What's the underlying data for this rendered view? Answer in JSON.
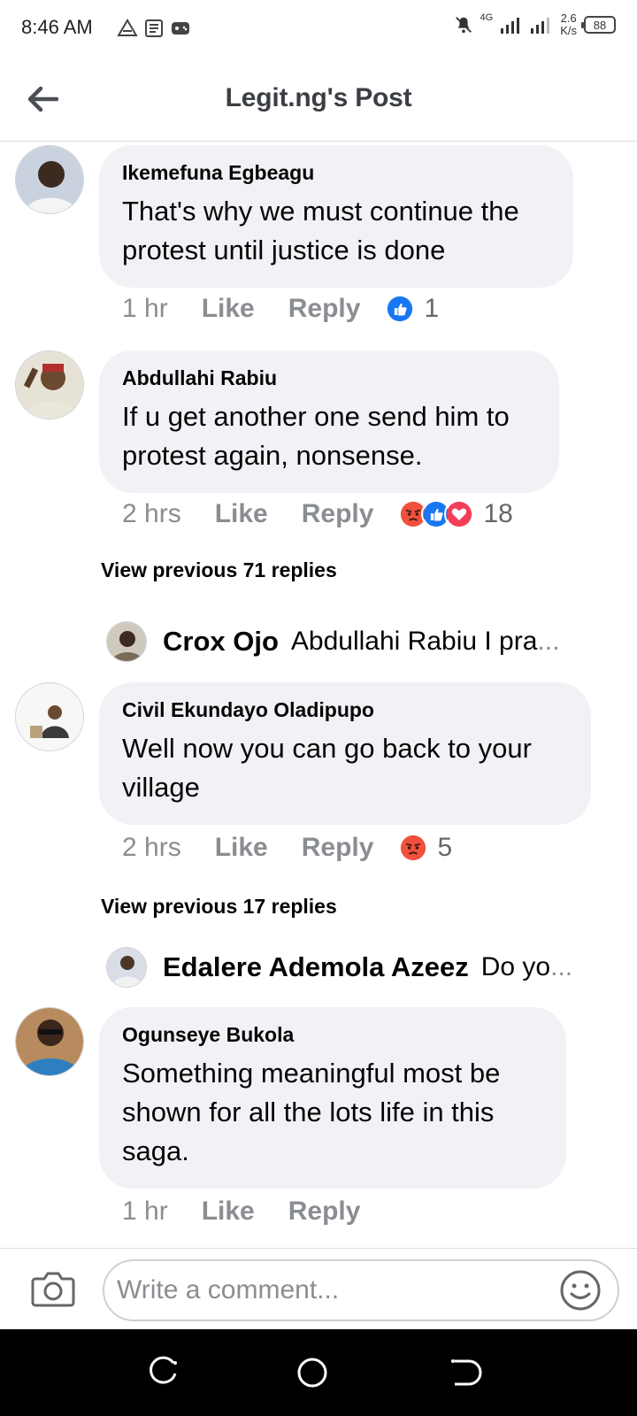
{
  "status_bar": {
    "time": "8:46 AM",
    "net_speed_value": "2.6",
    "net_speed_unit": "K/s",
    "battery": "88",
    "network": "4G"
  },
  "header": {
    "title": "Legit.ng's Post"
  },
  "comments": [
    {
      "author": "Ikemefuna Egbeagu",
      "text": "That's why we must continue the protest until justice is done",
      "time": "1 hr",
      "like_label": "Like",
      "reply_label": "Reply",
      "reaction_count": "1"
    },
    {
      "author": "Abdullahi Rabiu",
      "text": "If u get another one send him to protest again, nonsense.",
      "time": "2 hrs",
      "like_label": "Like",
      "reply_label": "Reply",
      "reaction_count": "18",
      "view_previous": "View previous 71 replies",
      "reply_preview": {
        "author": "Crox Ojo",
        "text": "Abdullahi Rabiu I pra",
        "ellipsis": "..."
      }
    },
    {
      "author": "Civil Ekundayo Oladipupo",
      "text": "Well now you can go back to your village",
      "time": "2 hrs",
      "like_label": "Like",
      "reply_label": "Reply",
      "reaction_count": "5",
      "view_previous": "View previous 17 replies",
      "reply_preview": {
        "author": "Edalere Ademola Azeez",
        "text": "Do yo",
        "ellipsis": "..."
      }
    },
    {
      "author": "Ogunseye Bukola",
      "text": "Something meaningful most be shown for all the lots life in this saga.",
      "time": "1 hr",
      "like_label": "Like",
      "reply_label": "Reply"
    }
  ],
  "composer": {
    "placeholder": "Write a comment..."
  },
  "colors": {
    "bubble": "#f0f2f5",
    "meta_text": "#8a8d91",
    "like_blue": "#1877f2",
    "angry": "#f0503c",
    "love": "#f33e58"
  }
}
